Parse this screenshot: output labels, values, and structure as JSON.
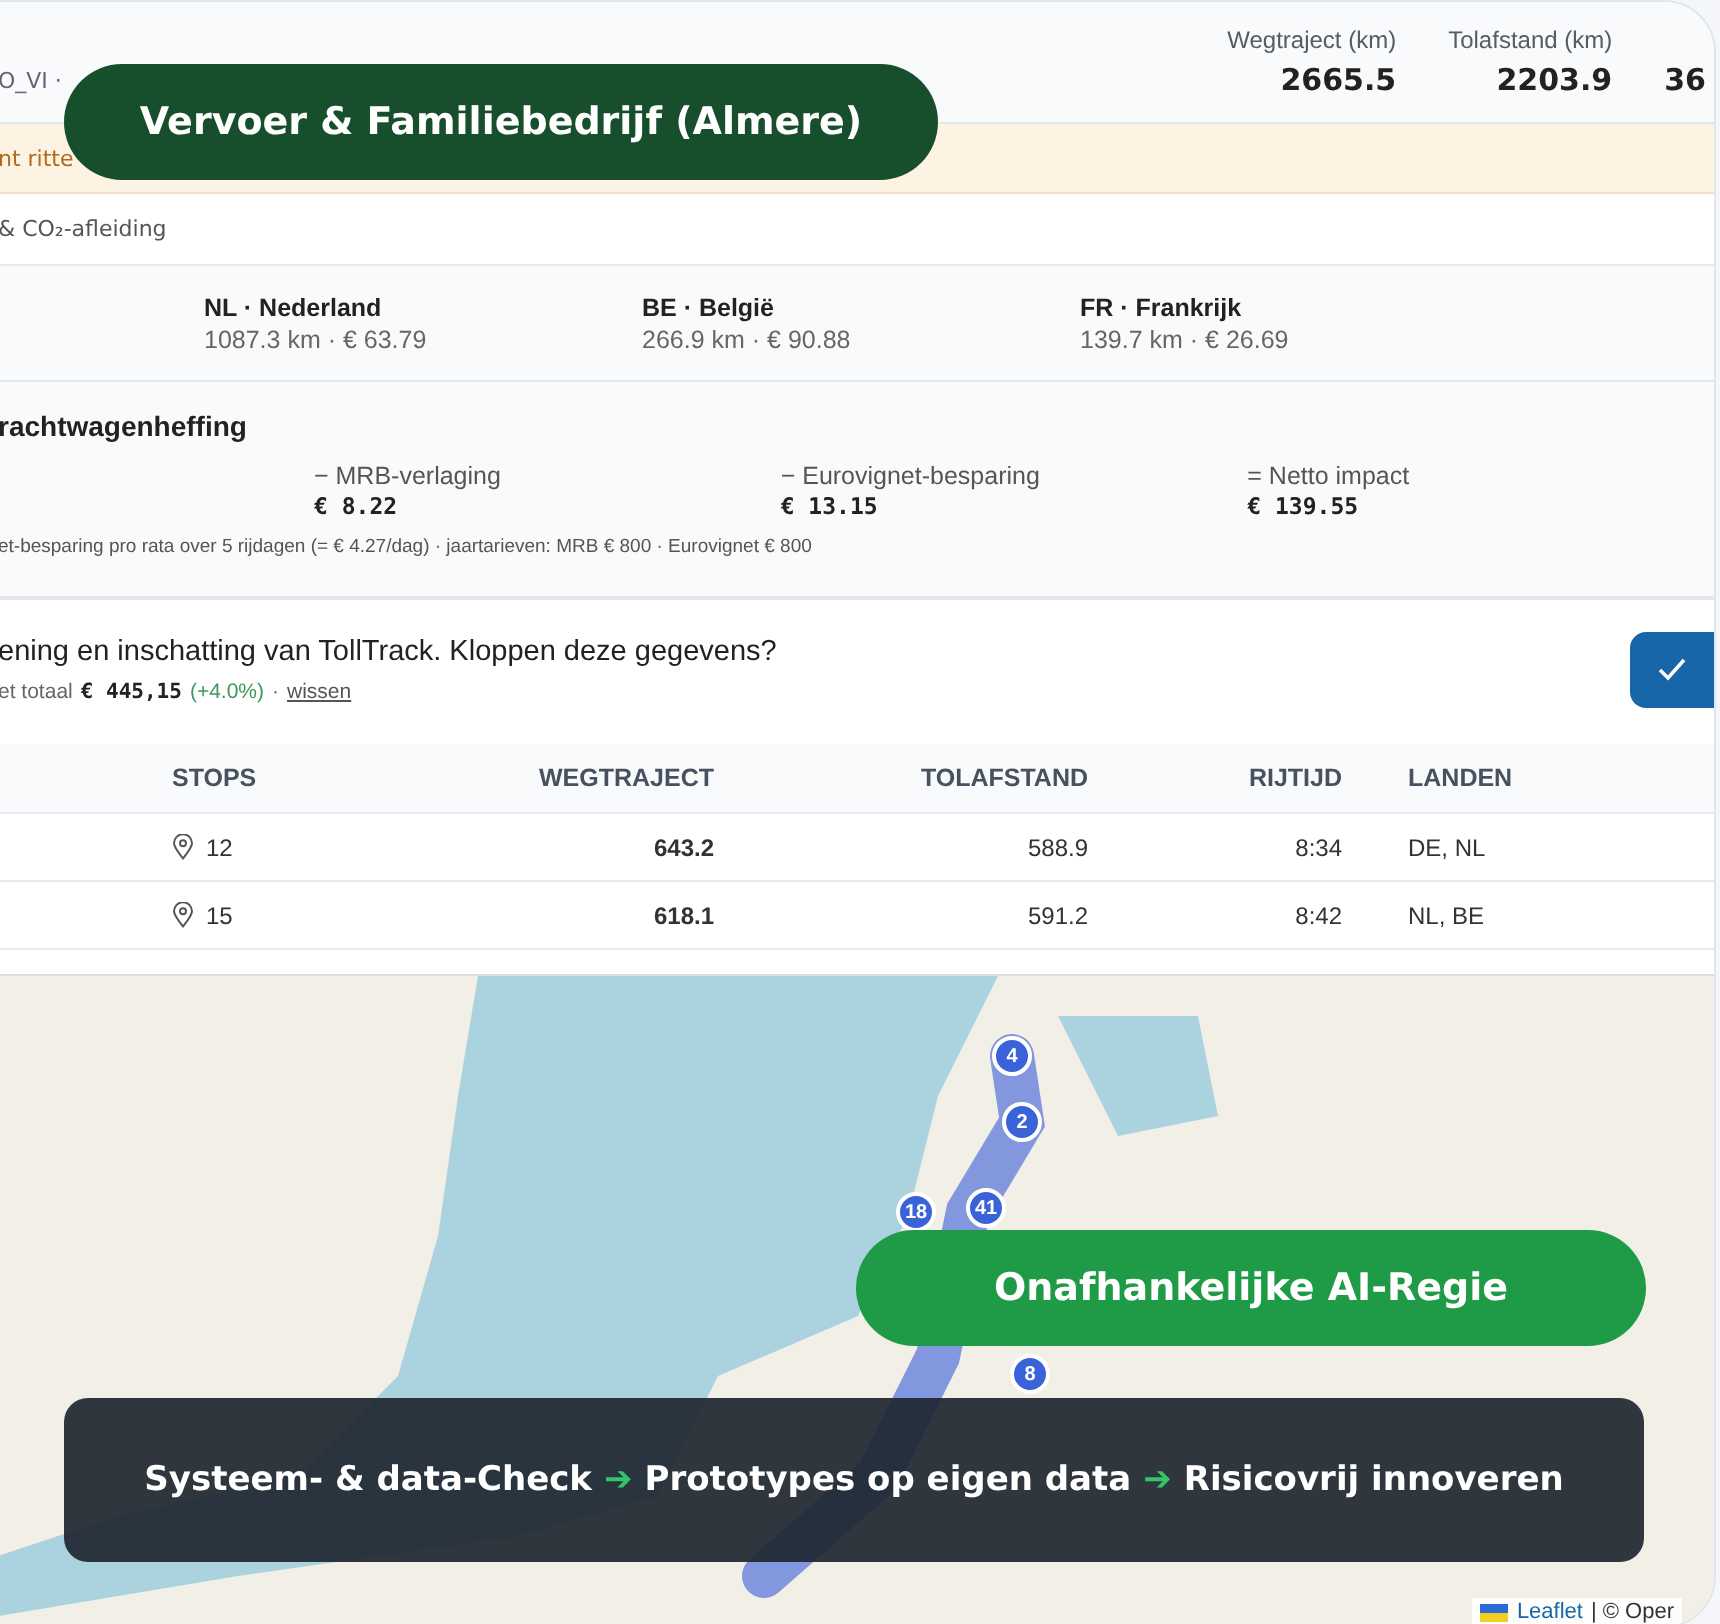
{
  "header": {
    "subtitle": "O_VI ·",
    "stats": [
      {
        "label": "Wegtraject (km)",
        "value": "2665.5"
      },
      {
        "label": "Tolafstand (km)",
        "value": "2203.9"
      },
      {
        "value": "36"
      }
    ]
  },
  "notice": {
    "text": "nt ritte"
  },
  "section_title": "& CO₂-afleiding",
  "countries": [
    {
      "name": "NL · Nederland",
      "detail": "1087.3 km · € 63.79"
    },
    {
      "name": "BE · België",
      "detail": "266.9 km · € 90.88"
    },
    {
      "name": "FR · Frankrijk",
      "detail": "139.7 km · € 26.69"
    }
  ],
  "truck_levy": {
    "title": "rachtwagenheffing",
    "items": [
      {
        "label": "− MRB-verlaging",
        "value": "€ 8.22"
      },
      {
        "label": "− Eurovignet-besparing",
        "value": "€ 13.15"
      },
      {
        "label": "= Netto impact",
        "value": "€ 139.55"
      }
    ],
    "note": "et-besparing pro rata over 5 rijdagen (= € 4.27/dag) · jaartarieven: MRB € 800 · Eurovignet € 800"
  },
  "confirm": {
    "question": "ening en inschatting van TollTrack. Kloppen deze gegevens?",
    "total_label": "et totaal",
    "total": "€ 445,15",
    "change": "(+4.0%)",
    "separator": "·",
    "clear_link": "wissen"
  },
  "table": {
    "columns": [
      "STOPS",
      "WEGTRAJECT",
      "TOLAFSTAND",
      "RIJTIJD",
      "LANDEN"
    ],
    "rows": [
      {
        "stops": "12",
        "route": "643.2",
        "toll": "588.9",
        "time": "8:34",
        "countries": "DE, NL"
      },
      {
        "stops": "15",
        "route": "618.1",
        "toll": "591.2",
        "time": "8:42",
        "countries": "NL, BE"
      }
    ]
  },
  "map": {
    "markers": [
      {
        "label": "4",
        "color": "#3b63d9"
      },
      {
        "label": "2",
        "color": "#3b63d9"
      },
      {
        "label": "18",
        "color": "#3b63d9"
      },
      {
        "label": "41",
        "color": "#3b63d9"
      },
      {
        "label": "8",
        "color": "#3b63d9"
      }
    ],
    "attribution_link": "Leaflet",
    "attribution_text": "| © Oper"
  },
  "company_badge": "Vervoer & Familiebedrijf (Almere)",
  "program_badge": "Onafhankelijke AI-Regie",
  "steps_banner": [
    {
      "kind": "step",
      "text": "Systeem- & data-Check"
    },
    {
      "kind": "arrow",
      "text": "➔"
    },
    {
      "kind": "step",
      "text": "Prototypes op eigen data"
    },
    {
      "kind": "arrow",
      "text": "➔"
    },
    {
      "kind": "step",
      "text": "Risicovrij innoveren"
    }
  ]
}
